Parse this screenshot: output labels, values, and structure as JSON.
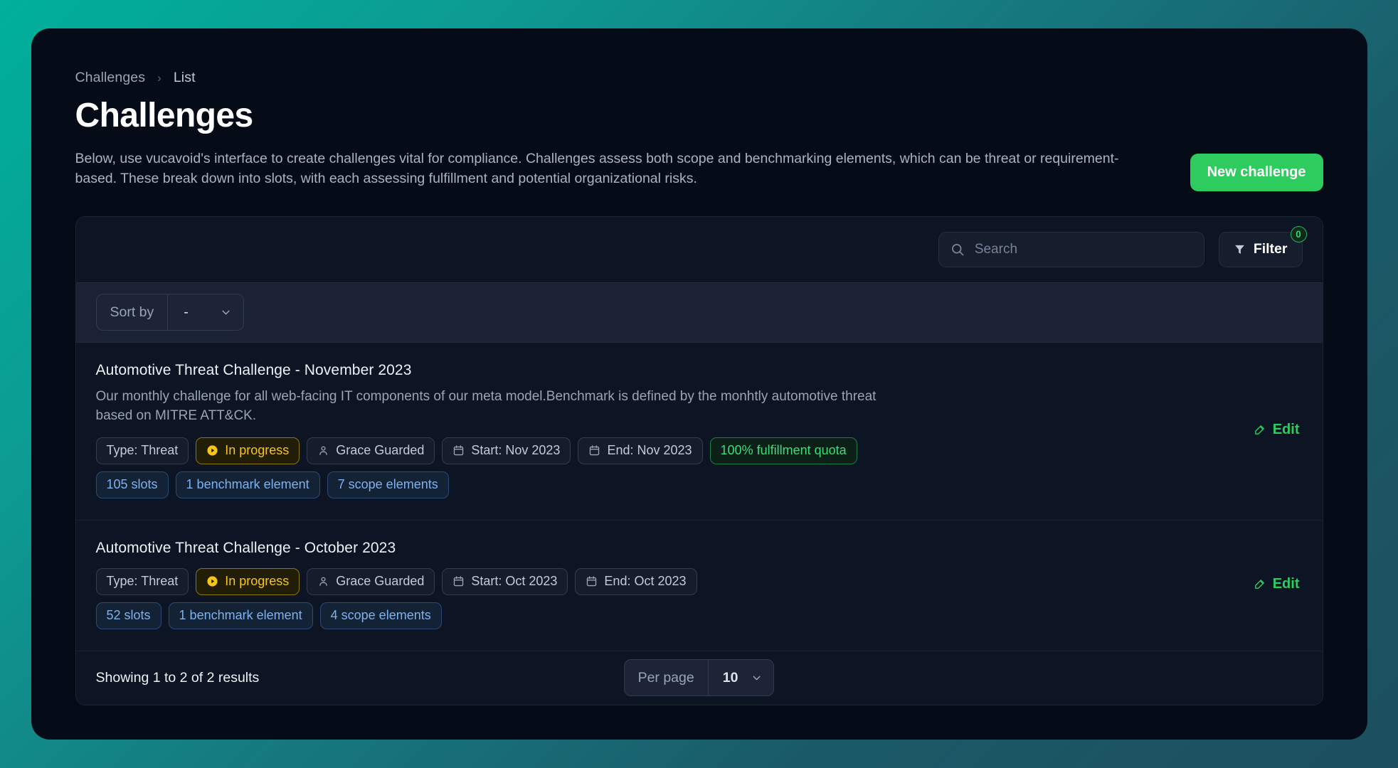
{
  "breadcrumb": {
    "root": "Challenges",
    "separator": "›",
    "current": "List"
  },
  "header": {
    "title": "Challenges",
    "description": "Below, use vucavoid's interface to create challenges vital for compliance. Challenges assess both scope and benchmarking elements, which can be threat or requirement-based. These break down into slots, with each assessing fulfillment and potential organizational risks.",
    "new_challenge_label": "New challenge"
  },
  "toolbar": {
    "search_placeholder": "Search",
    "search_value": "",
    "search_icon": "search-icon",
    "filter_label": "Filter",
    "filter_icon": "funnel-icon",
    "filter_count": "0"
  },
  "sort": {
    "label": "Sort by",
    "value": "-",
    "chevron_icon": "chevron-down-icon"
  },
  "rows": [
    {
      "title": "Automotive Threat Challenge - November 2023",
      "description": "Our monthly challenge for all web-facing IT components of our meta model.Benchmark is defined by the monhtly automotive threat based on MITRE ATT&CK.",
      "badges": [
        {
          "label": "Type: Threat",
          "style": "default",
          "icon": ""
        },
        {
          "label": "In progress",
          "style": "status-progress",
          "icon": "play-circle-icon"
        },
        {
          "label": "Grace Guarded",
          "style": "default",
          "icon": "user-icon"
        },
        {
          "label": "Start: Nov 2023",
          "style": "default",
          "icon": "calendar-icon"
        },
        {
          "label": "End: Nov 2023",
          "style": "default",
          "icon": "calendar-icon"
        },
        {
          "label": "100% fulfillment quota",
          "style": "quota",
          "icon": ""
        }
      ],
      "counts": [
        {
          "label": "105 slots"
        },
        {
          "label": "1 benchmark element"
        },
        {
          "label": "7 scope elements"
        }
      ],
      "edit_label": "Edit",
      "edit_icon": "edit-pencil-icon"
    },
    {
      "title": "Automotive Threat Challenge - October 2023",
      "description": "",
      "badges": [
        {
          "label": "Type: Threat",
          "style": "default",
          "icon": ""
        },
        {
          "label": "In progress",
          "style": "status-progress",
          "icon": "play-circle-icon"
        },
        {
          "label": "Grace Guarded",
          "style": "default",
          "icon": "user-icon"
        },
        {
          "label": "Start: Oct 2023",
          "style": "default",
          "icon": "calendar-icon"
        },
        {
          "label": "End: Oct 2023",
          "style": "default",
          "icon": "calendar-icon"
        }
      ],
      "counts": [
        {
          "label": "52 slots"
        },
        {
          "label": "1 benchmark element"
        },
        {
          "label": "4 scope elements"
        }
      ],
      "edit_label": "Edit",
      "edit_icon": "edit-pencil-icon"
    }
  ],
  "footer": {
    "results_text": "Showing 1 to 2 of 2 results",
    "per_page_label": "Per page",
    "per_page_value": "10",
    "chevron_icon": "chevron-down-icon"
  },
  "colors": {
    "accent_green": "#2ecc5f",
    "status_yellow": "#f5c518",
    "count_blue": "#7db2f0",
    "quota_green": "#3ddc7f",
    "page_bg_start": "#00b09a",
    "page_bg_end": "#1d4f5e",
    "card_bg": "#060c17",
    "panel_bg": "#0d1423"
  }
}
